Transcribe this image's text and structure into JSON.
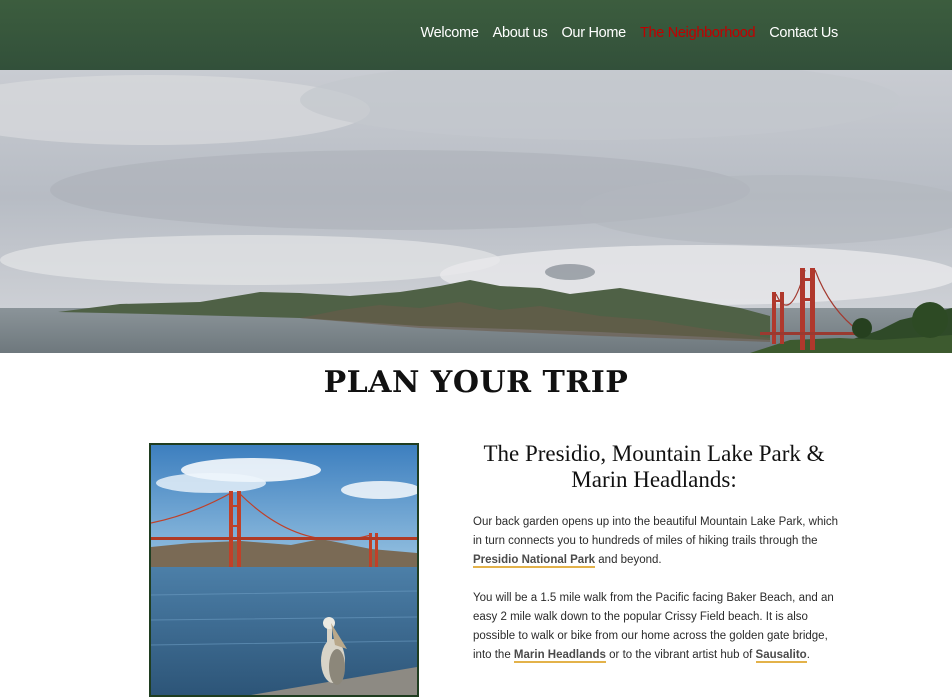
{
  "nav": {
    "items": [
      {
        "label": "Welcome",
        "active": false
      },
      {
        "label": "About us",
        "active": false
      },
      {
        "label": "Our Home",
        "active": false
      },
      {
        "label": "The Neighborhood",
        "active": true
      },
      {
        "label": "Contact Us",
        "active": false
      }
    ]
  },
  "hero": {
    "image": "golden-gate-headlands-panorama"
  },
  "page": {
    "title": "PLAN YOUR TRIP"
  },
  "photo": {
    "image": "golden-gate-bridge-with-pelican"
  },
  "section": {
    "title": "The Presidio, Mountain Lake Park & Marin Headlands:",
    "para1": {
      "text_before": "Our back garden opens up into the beautiful Mountain Lake Park, which in turn connects you to hundreds of miles of hiking trails through the ",
      "link": "Presidio National Park",
      "text_after": " and beyond."
    },
    "para2": {
      "text_before": "You will be a 1.5 mile walk from the Pacific facing Baker Beach, and an easy 2 mile walk down to the popular Crissy Field beach. It is also possible to walk or bike from our home across the golden gate bridge, into the ",
      "link1": "Marin Headlands",
      "text_middle": " or to the vibrant artist hub of ",
      "link2": "Sausalito",
      "text_after": "."
    }
  },
  "colors": {
    "nav_bg": "#35533a",
    "nav_active": "#c00000",
    "link_underline": "#e3b24a"
  }
}
